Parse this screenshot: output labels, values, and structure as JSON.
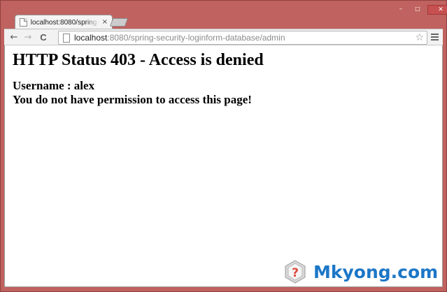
{
  "window": {
    "frame_color": "#c0625f",
    "controls": {
      "minimize": "–",
      "maximize": "□",
      "close": "✕"
    }
  },
  "tabs": [
    {
      "title": "localhost:8080/spring-security-loginform-database/admin",
      "close": "×"
    }
  ],
  "toolbar": {
    "back": "←",
    "forward": "→",
    "reload": "C",
    "url_host": "localhost",
    "url_path": ":8080/spring-security-loginform-database/admin",
    "star": "☆"
  },
  "page": {
    "title": "HTTP Status 403 - Access is denied",
    "username_line": "Username : alex",
    "message": "You do not have permission to access this page!"
  },
  "watermark": {
    "text": "Mkyong.com",
    "brand_color": "#1c77c7",
    "logo_accent": "#e0483c"
  }
}
